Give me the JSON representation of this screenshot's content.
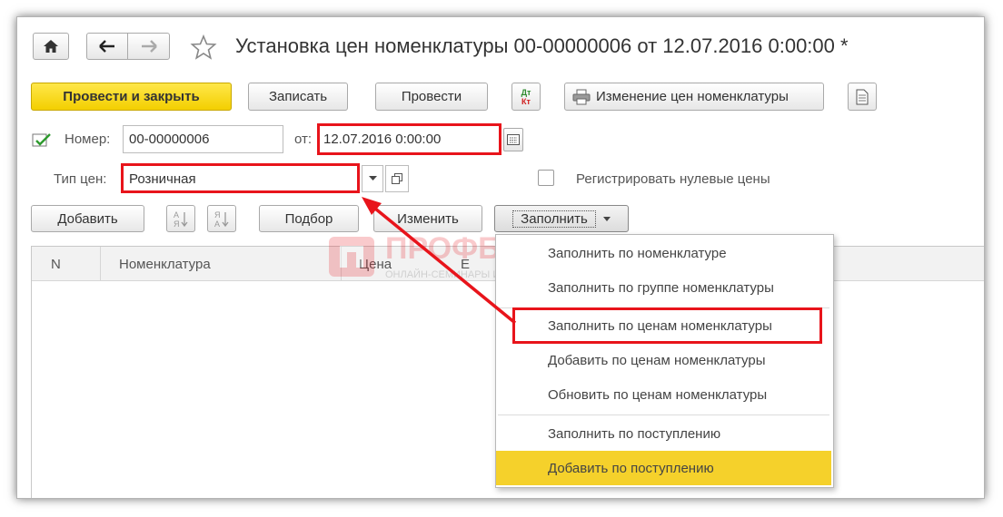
{
  "window": {
    "title": "Установка цен номенклатуры 00-00000006 от 12.07.2016 0:00:00 *"
  },
  "toolbar": {
    "post_close_label": "Провести и закрыть",
    "save_label": "Записать",
    "post_label": "Провести",
    "dtkt_top": "Дт",
    "dtkt_bottom": "Кт",
    "price_change_label": "Изменение цен номенклатуры"
  },
  "form": {
    "number_label": "Номер:",
    "number_value": "00-00000006",
    "from_label": "от:",
    "date_value": "12.07.2016  0:00:00",
    "price_type_label": "Тип цен:",
    "price_type_value": "Розничная",
    "register_zero_label": "Регистрировать нулевые цены",
    "register_zero_checked": false
  },
  "table_toolbar": {
    "add_label": "Добавить",
    "sort_asc_letters": "АЯ",
    "sort_desc_letters": "ЯА",
    "select_label": "Подбор",
    "change_label": "Изменить",
    "fill_label": "Заполнить"
  },
  "table": {
    "columns": [
      "N",
      "Номенклатура",
      "Цена",
      "Е"
    ]
  },
  "fill_menu": {
    "items": [
      "Заполнить по номенклатуре",
      "Заполнить по группе номенклатуры",
      "Заполнить по ценам номенклатуры",
      "Добавить по ценам номенклатуры",
      "Обновить по ценам номенклатуры",
      "Заполнить по поступлению",
      "Добавить по поступлению"
    ],
    "highlighted_index": 6
  },
  "watermark": {
    "brand": "ПРОФБУХ8.РУ",
    "tagline": "ОНЛАЙН-СЕМИНАРЫ И ВИДЕОКУРСЫ 1С:8"
  },
  "colors": {
    "primary_button": "#f3cf00",
    "highlight_row": "#f5d12b",
    "annotation_red": "#e8141b",
    "watermark": "#e8141b"
  }
}
